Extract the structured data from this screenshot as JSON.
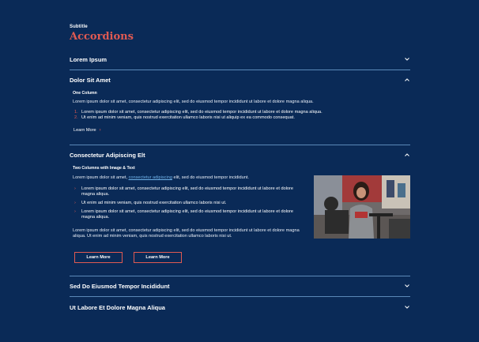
{
  "header": {
    "subtitle": "Subtitle",
    "title": "Accordions"
  },
  "accordions": [
    {
      "title": "Lorem Ipsum",
      "state": "collapsed",
      "icon": "chevron-down-icon"
    },
    {
      "title": "Dolor Sit Amet",
      "state": "expanded",
      "icon": "chevron-up-icon",
      "heading": "One Column",
      "paragraph": "Lorem ipsum dolor sit amet, consectetur adipiscing elit, sed do eiusmod tempor incididunt ut labore et dolore magna aliqua.",
      "list": [
        {
          "num": "1.",
          "text": "Lorem ipsum dolor sit amet, consectetur adipiscing elit, sed do eiusmod tempor incididunt ut labore et dolore magna aliqua."
        },
        {
          "num": "2.",
          "text": "Ut enim ad minim veniam, quis nostrud exercitation ullamco laboris nisi ut aliquip ex ea commodo consequat."
        }
      ],
      "link_label": "Learn More"
    },
    {
      "title": "Consectetur Adipiscing Elt",
      "state": "expanded",
      "icon": "chevron-up-icon",
      "heading": "Two Columns with Image & Text",
      "intro_before": "Lorem ipsum dolor sit amet, ",
      "intro_link": "consectetur adipiscing",
      "intro_after": " elit, sed do eiusmod tempor incididunt.",
      "bullets": [
        "Lorem ipsum dolor sit amet, consectetur adipiscing elit, sed do eiusmod tempor incididunt ut labore et dolore magna aliqua.",
        "Ut enim ad minim veniam, quis nostrud exercitation ullamco laboris nisi ut.",
        "Lorem ipsum dolor sit amet, consectetur adipiscing elit, sed do eiusmod tempor incididunt ut labore et dolore magna aliqua."
      ],
      "paragraph": "Lorem ipsum dolor sit amet, consectetur adipiscing elit, sed do eiusmod tempor incididunt ut labore et dolore magna aliqua. Ut enim ad minim veniam, quis nostrud exercitation ullamco laboris nisi ut.",
      "buttons": [
        "Learn More",
        "Learn More"
      ]
    },
    {
      "title": "Sed Do Eiusmod Tempor Incididunt",
      "state": "collapsed",
      "icon": "chevron-down-icon"
    },
    {
      "title": "Ut Labore Et Dolore Magna Aliqua",
      "state": "collapsed",
      "icon": "chevron-down-icon"
    }
  ],
  "colors": {
    "background": "#0a2a57",
    "accent": "#e05a52",
    "rule": "#5b89b8",
    "link": "#6fb1e8"
  }
}
